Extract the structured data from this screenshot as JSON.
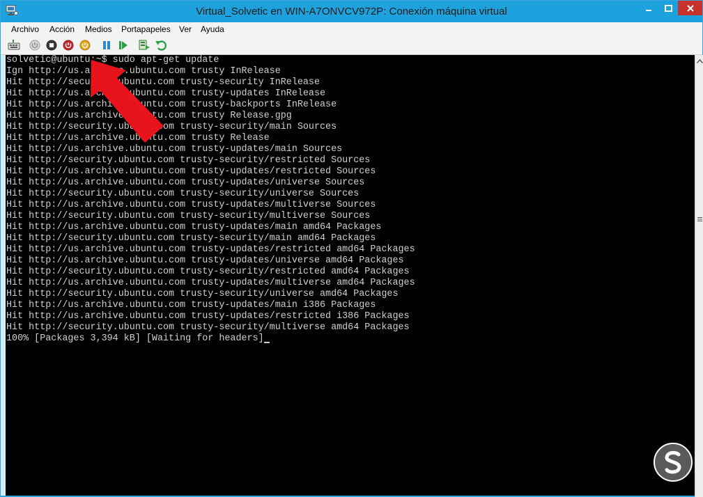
{
  "window": {
    "title": "Virtual_Solvetic en WIN-A7ONVCV972P: Conexión máquina virtual"
  },
  "menu": [
    "Archivo",
    "Acción",
    "Medios",
    "Portapapeles",
    "Ver",
    "Ayuda"
  ],
  "toolbar": {
    "icons": [
      "ctrl-alt-del-icon",
      "start-icon",
      "stop-icon",
      "shutdown-icon",
      "power-icon",
      "pause-icon",
      "resume-icon",
      "checkpoint-icon",
      "revert-icon"
    ]
  },
  "terminal": {
    "lines": [
      "solvetic@ubuntu:~$ sudo apt-get update",
      "Ign http://us.archive.ubuntu.com trusty InRelease",
      "Hit http://security.ubuntu.com trusty-security InRelease",
      "Hit http://us.archive.ubuntu.com trusty-updates InRelease",
      "Hit http://us.archive.ubuntu.com trusty-backports InRelease",
      "Hit http://us.archive.ubuntu.com trusty Release.gpg",
      "Hit http://security.ubuntu.com trusty-security/main Sources",
      "Hit http://us.archive.ubuntu.com trusty Release",
      "Hit http://us.archive.ubuntu.com trusty-updates/main Sources",
      "Hit http://security.ubuntu.com trusty-security/restricted Sources",
      "Hit http://us.archive.ubuntu.com trusty-updates/restricted Sources",
      "Hit http://us.archive.ubuntu.com trusty-updates/universe Sources",
      "Hit http://security.ubuntu.com trusty-security/universe Sources",
      "Hit http://us.archive.ubuntu.com trusty-updates/multiverse Sources",
      "Hit http://security.ubuntu.com trusty-security/multiverse Sources",
      "Hit http://us.archive.ubuntu.com trusty-updates/main amd64 Packages",
      "Hit http://security.ubuntu.com trusty-security/main amd64 Packages",
      "Hit http://us.archive.ubuntu.com trusty-updates/restricted amd64 Packages",
      "Hit http://us.archive.ubuntu.com trusty-updates/universe amd64 Packages",
      "Hit http://security.ubuntu.com trusty-security/restricted amd64 Packages",
      "Hit http://us.archive.ubuntu.com trusty-updates/multiverse amd64 Packages",
      "Hit http://security.ubuntu.com trusty-security/universe amd64 Packages",
      "Hit http://us.archive.ubuntu.com trusty-updates/main i386 Packages",
      "Hit http://us.archive.ubuntu.com trusty-updates/restricted i386 Packages",
      "Hit http://security.ubuntu.com trusty-security/multiverse amd64 Packages",
      "100% [Packages 3,394 kB] [Waiting for headers]"
    ]
  },
  "colors": {
    "titlebar": "#1ea2de",
    "close": "#c7332b",
    "terminal_bg": "#000000",
    "terminal_text": "#d0d0d0",
    "arrow": "#e8141b"
  }
}
